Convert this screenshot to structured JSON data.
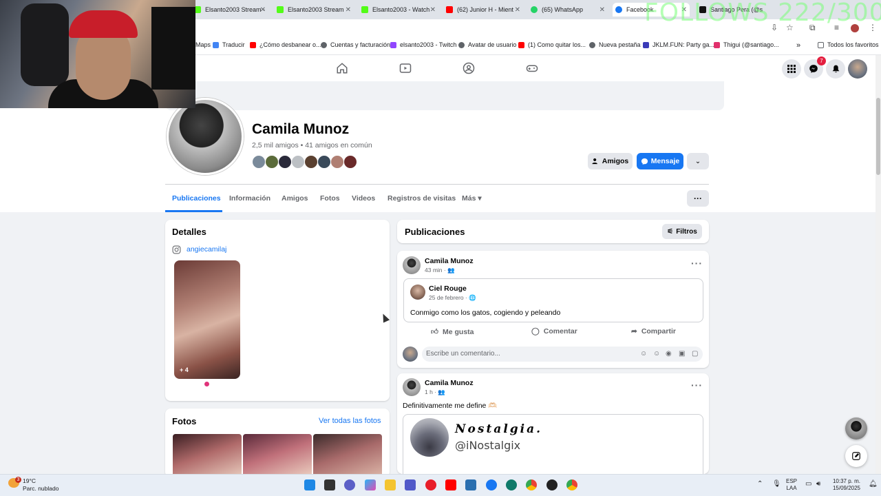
{
  "overlay": {
    "follows_text": "FOLLOWS 222/300"
  },
  "browser": {
    "tabs": [
      {
        "label": "Elsanto2003 Stream -",
        "color": "#53fc18"
      },
      {
        "label": "Elsanto2003 Stream",
        "color": "#53fc18"
      },
      {
        "label": "Elsanto2003 - Watch",
        "color": "#53fc18"
      },
      {
        "label": "(62) Junior H - Mient",
        "color": "#ff0000"
      },
      {
        "label": "(65) WhatsApp",
        "color": "#25d366"
      },
      {
        "label": "Facebook",
        "color": "#1877f2"
      },
      {
        "label": "Santiago Pera (@s",
        "color": "#111111"
      }
    ],
    "bookmarks": [
      {
        "label": "Maps",
        "color": "#34a853"
      },
      {
        "label": "Traducir",
        "color": "#4285f4"
      },
      {
        "label": "¿Cómo desbanear o...",
        "color": "#ff0000"
      },
      {
        "label": "Cuentas y facturación",
        "color": "#5f6368"
      },
      {
        "label": "elsanto2003 - Twitch",
        "color": "#9146ff"
      },
      {
        "label": "Avatar de usuario",
        "color": "#5f6368"
      },
      {
        "label": "(1) Como quitar los...",
        "color": "#ff0000"
      },
      {
        "label": "Nueva pestaña",
        "color": "#5f6368"
      },
      {
        "label": "JKLM.FUN: Party ga...",
        "color": "#3b3bb8"
      },
      {
        "label": "Thigui (@santiago...",
        "color": "#e1306c"
      }
    ],
    "all_bookmarks": "Todos los favoritos",
    "more_bookmarks": "»"
  },
  "fb": {
    "messenger_badge": "7",
    "profile": {
      "name": "Camila Munoz",
      "friends": "2,5 mil amigos • 41 amigos en común",
      "friends_button": "Amigos",
      "message_button": "Mensaje"
    },
    "tabs": [
      "Publicaciones",
      "Información",
      "Amigos",
      "Fotos",
      "Videos",
      "Registros de visitas",
      "Más ▾"
    ],
    "details": {
      "title": "Detalles",
      "instagram": "angiecamilaj",
      "featured_more": "+ 4"
    },
    "photos": {
      "title": "Fotos",
      "see_all": "Ver todas las fotos"
    },
    "posts_header": {
      "title": "Publicaciones",
      "filters": "Filtros"
    },
    "post1": {
      "author": "Camila Munoz",
      "time": "43 min · ",
      "shared_author": "Ciel Rouge",
      "shared_date": "25 de febrero · ",
      "shared_text": "Conmigo como los gatos, cogiendo y peleando",
      "like": "Me gusta",
      "comment": "Comentar",
      "share": "Compartir",
      "comment_placeholder": "Escribe un comentario..."
    },
    "post2": {
      "author": "Camila Munoz",
      "time": "1 h · ",
      "text": "Definitivamente me define 🫶🏻",
      "shared_title": "Nostalgia.",
      "shared_handle": "@iNostalgix"
    }
  },
  "taskbar": {
    "weather_temp": "19°C",
    "weather_desc": "Parc. nublado",
    "weather_badge": "3",
    "lang_1": "ESP",
    "lang_2": "LAA",
    "time": "10:37 p. m.",
    "date": "15/09/2025"
  }
}
